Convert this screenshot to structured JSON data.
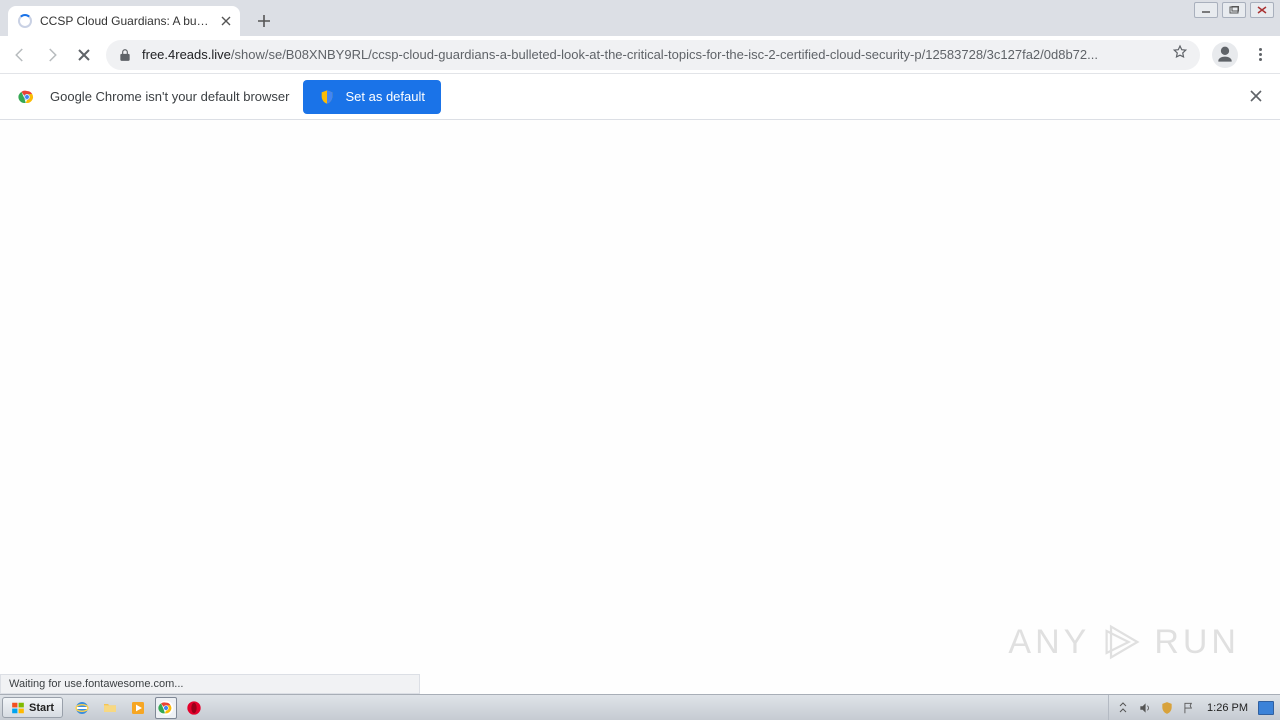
{
  "tab": {
    "title": "CCSP Cloud Guardians: A bulleted lo"
  },
  "toolbar": {
    "url_host": "free.4reads.live",
    "url_path": "/show/se/B08XNBY9RL/ccsp-cloud-guardians-a-bulleted-look-at-the-critical-topics-for-the-isc-2-certified-cloud-security-p/12583728/3c127fa2/0d8b72..."
  },
  "infobar": {
    "message": "Google Chrome isn't your default browser",
    "button_label": "Set as default"
  },
  "status": {
    "text": "Waiting for use.fontawesome.com..."
  },
  "watermark": {
    "left": "ANY",
    "right": "RUN"
  },
  "taskbar": {
    "start_label": "Start",
    "clock": "1:26 PM"
  }
}
